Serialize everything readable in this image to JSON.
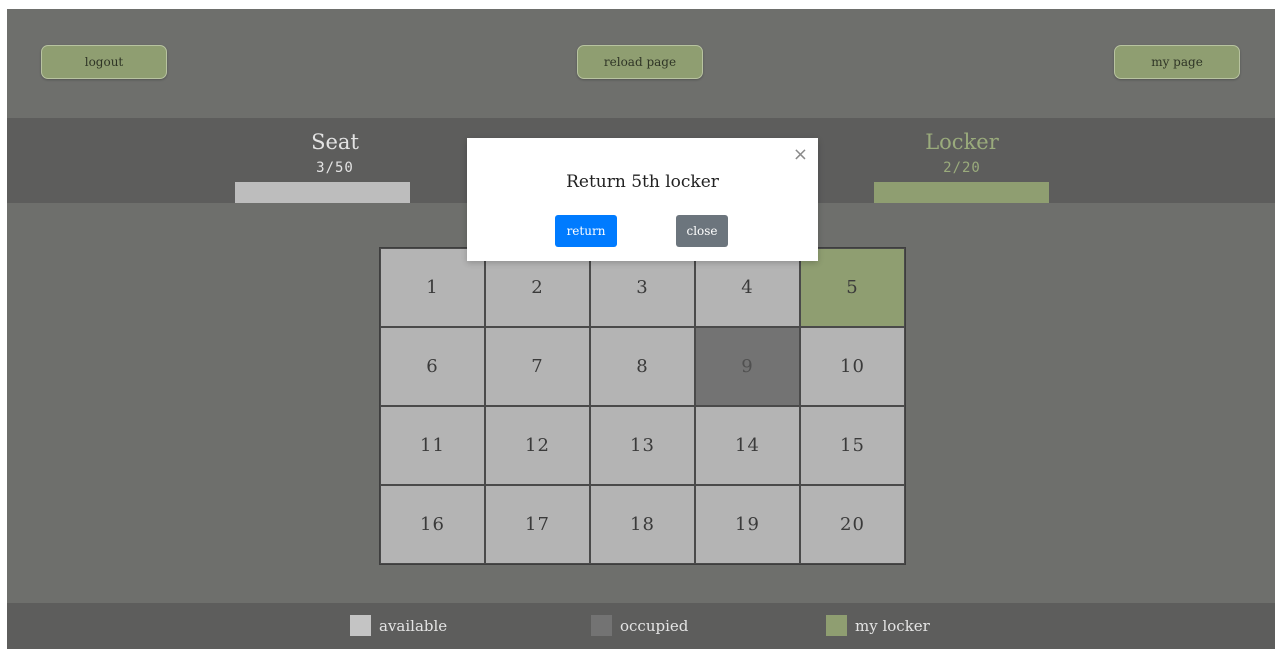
{
  "topbar": {
    "logout_label": "logout",
    "reload_label": "reload page",
    "mypage_label": "my page"
  },
  "stats": {
    "seat": {
      "label": "Seat",
      "count": "3/50",
      "used": 3,
      "total": 50
    },
    "locker": {
      "label": "Locker",
      "count": "2/20",
      "used": 2,
      "total": 20
    }
  },
  "lockers": [
    {
      "number": "1",
      "status": "available"
    },
    {
      "number": "2",
      "status": "available"
    },
    {
      "number": "3",
      "status": "available"
    },
    {
      "number": "4",
      "status": "available"
    },
    {
      "number": "5",
      "status": "mine"
    },
    {
      "number": "6",
      "status": "available"
    },
    {
      "number": "7",
      "status": "available"
    },
    {
      "number": "8",
      "status": "available"
    },
    {
      "number": "9",
      "status": "occupied"
    },
    {
      "number": "10",
      "status": "available"
    },
    {
      "number": "11",
      "status": "available"
    },
    {
      "number": "12",
      "status": "available"
    },
    {
      "number": "13",
      "status": "available"
    },
    {
      "number": "14",
      "status": "available"
    },
    {
      "number": "15",
      "status": "available"
    },
    {
      "number": "16",
      "status": "available"
    },
    {
      "number": "17",
      "status": "available"
    },
    {
      "number": "18",
      "status": "available"
    },
    {
      "number": "19",
      "status": "available"
    },
    {
      "number": "20",
      "status": "available"
    }
  ],
  "legend": {
    "available": "available",
    "occupied": "occupied",
    "mine": "my locker"
  },
  "modal": {
    "title": "Return 5th locker",
    "return_label": "return",
    "close_label": "close",
    "close_icon": "×"
  },
  "colors": {
    "available": "#b4b4b4",
    "occupied": "#737373",
    "mine": "#8f9e71",
    "primary": "#007bff",
    "secondary": "#6c757d",
    "seat_accent": "#e0e0e0",
    "locker_accent": "#9aab7c"
  }
}
